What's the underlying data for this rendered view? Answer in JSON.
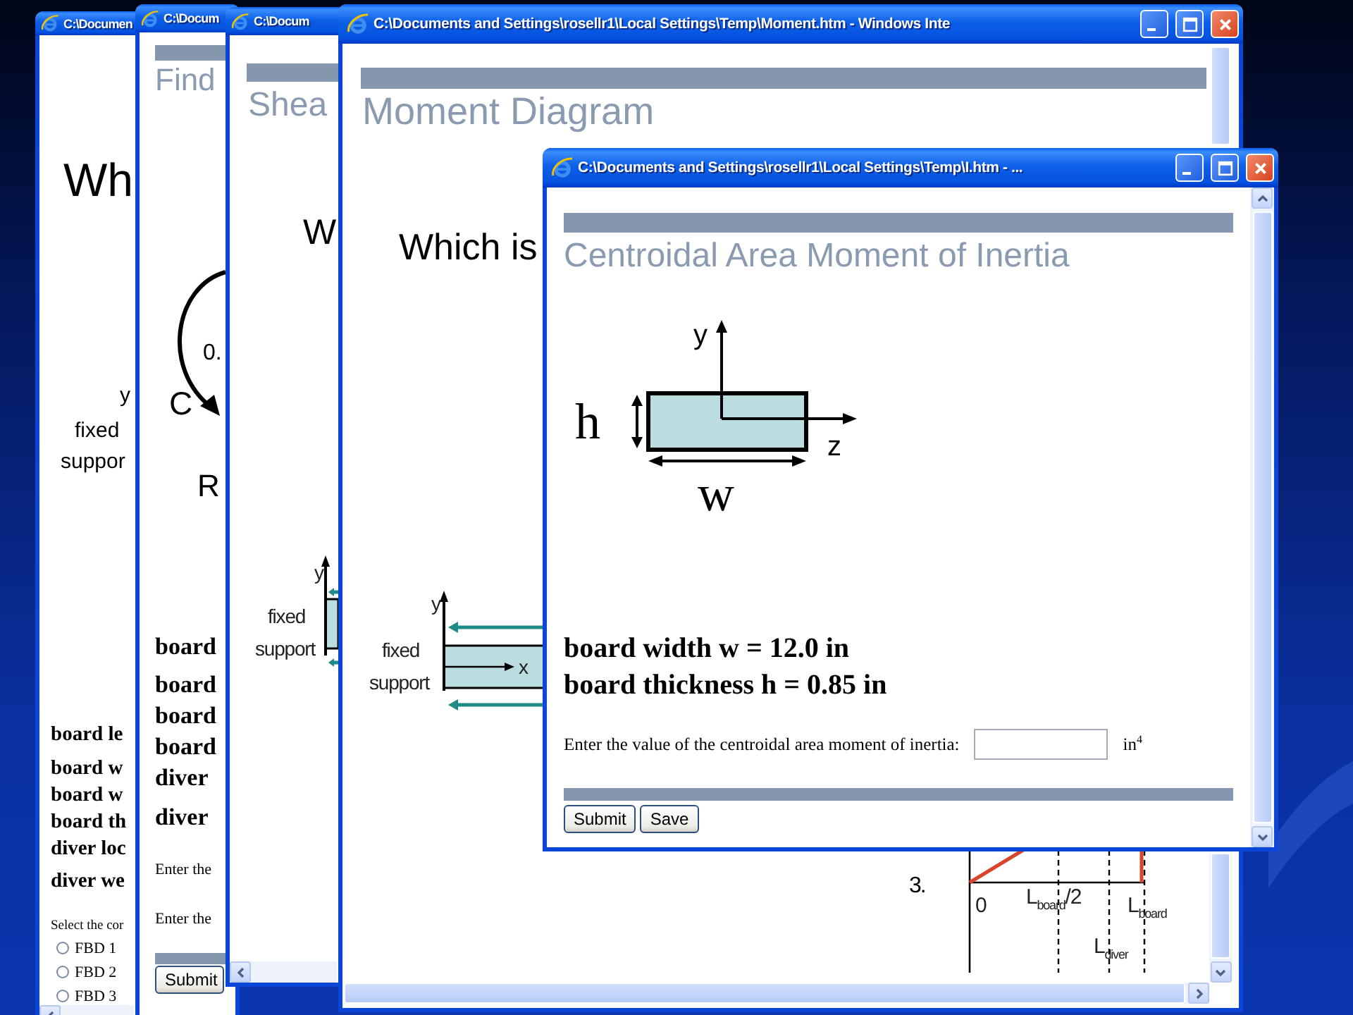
{
  "windows": [
    {
      "kind": "fbd",
      "title": "C:\\Documen",
      "question": "Wh",
      "diagram_labels": [
        "y",
        "fixed",
        "suppor"
      ],
      "given": [
        "board le",
        "board w",
        "board w",
        "board th",
        "diver loc",
        "diver we"
      ],
      "prompt": "Select the cor",
      "options": [
        {
          "label": "FBD 1",
          "selected": false
        },
        {
          "label": "FBD 2",
          "selected": false
        },
        {
          "label": "FBD 3",
          "selected": false
        }
      ]
    },
    {
      "kind": "reactions",
      "title": "C:\\Docum",
      "heading": "Find",
      "diagram_labels": [
        "0.",
        "C",
        "R"
      ],
      "given": [
        "board",
        "board",
        "board",
        "board",
        "diver",
        "diver"
      ],
      "prompts": [
        "Enter the",
        "Enter the"
      ],
      "button": "Submit"
    },
    {
      "kind": "shear",
      "title": "C:\\Docum",
      "heading": "Shea",
      "question": "W",
      "diagram_labels": [
        "y",
        "fixed",
        "support"
      ]
    },
    {
      "kind": "moment",
      "title": "C:\\Documents and Settings\\rosellr1\\Local Settings\\Temp\\Moment.htm - Windows Inte",
      "heading": "Moment Diagram",
      "question": "Which is",
      "diagram_labels": [
        "y",
        "fixed",
        "support",
        "x"
      ],
      "option_number": "3.",
      "axis_labels": [
        "0",
        "L$_{board}$/2",
        "L$_{board}$",
        "L$_{diver}$"
      ]
    },
    {
      "kind": "inertia",
      "title": "C:\\Documents and Settings\\rosellr1\\Local Settings\\Temp\\I.htm - ...",
      "heading": "Centroidal Area Moment of Inertia",
      "diagram_labels": [
        "y",
        "h",
        "z",
        "w"
      ],
      "given": [
        "board width w = 12.0 in",
        "board thickness h = 0.85 in"
      ],
      "prompt": "Enter the value of the centroidal area moment of inertia:",
      "unit": "in$^{4}$",
      "buttons": [
        "Submit",
        "Save"
      ]
    }
  ]
}
